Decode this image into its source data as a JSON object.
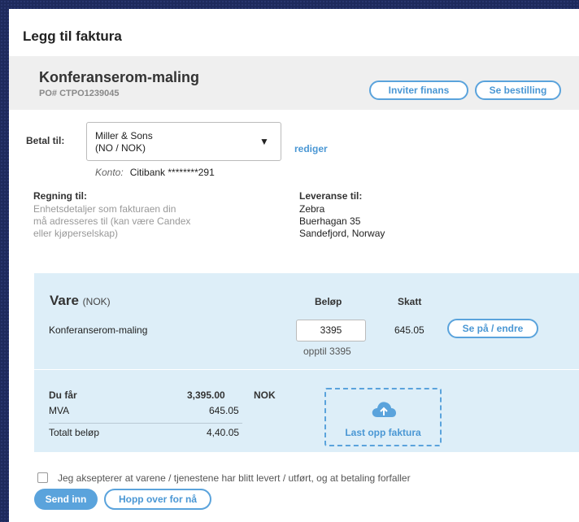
{
  "dialog": {
    "title": "Legg til faktura"
  },
  "order": {
    "name": "Konferanserom-maling",
    "po": "PO# CTPO1239045",
    "invite_finance_label": "Inviter finans",
    "view_order_label": "Se bestilling"
  },
  "payee": {
    "label": "Betal til:",
    "selected_line1": "Miller & Sons",
    "selected_line2": "(NO / NOK)",
    "edit_label": "rediger",
    "account_label": "Konto:",
    "account_value": "Citibank  ********291"
  },
  "billing": {
    "label": "Regning til:",
    "lines": [
      "Enhetsdetaljer som fakturaen din",
      "må adresseres til (kan være Candex",
      "eller kjøperselskap)"
    ]
  },
  "delivery": {
    "label": "Leveranse til:",
    "lines": [
      "Zebra",
      "Buerhagan 35",
      "Sandefjord, Norway"
    ]
  },
  "items": {
    "heading": "Vare",
    "currency": "(NOK)",
    "col_amount": "Beløp",
    "col_tax": "Skatt",
    "rows": [
      {
        "name": "Konferanserom-maling",
        "amount": "3395",
        "limit": "opptil 3395",
        "tax": "645.05",
        "action": "Se på / endre"
      }
    ]
  },
  "summary": {
    "you_get_label": "Du får",
    "you_get_value": "3,395.00",
    "currency": "NOK",
    "vat_label": "MVA",
    "vat_value": "645.05",
    "total_label": "Totalt beløp",
    "total_value": "4,40.05"
  },
  "upload": {
    "label": "Last opp faktura",
    "icon": "cloud-upload-icon"
  },
  "terms": {
    "text": "Jeg aksepterer at varene / tjenestene har blitt levert / utført, og at betaling forfaller",
    "checked": false
  },
  "actions": {
    "submit_label": "Send inn",
    "skip_label": "Hopp over for nå"
  },
  "colors": {
    "accent": "#5aa3dc",
    "panel_bg": "#ddeef8",
    "backdrop": "#1e2a5c"
  }
}
